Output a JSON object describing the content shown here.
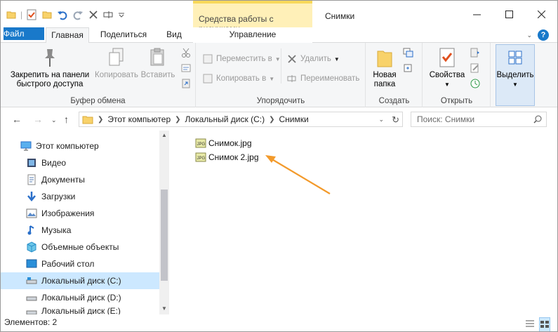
{
  "window": {
    "title": "Снимки"
  },
  "contextual_tab": {
    "header": "Средства работы с рисунками",
    "tab": "Управление"
  },
  "tabs": {
    "file": "Файл",
    "home": "Главная",
    "share": "Поделиться",
    "view": "Вид"
  },
  "ribbon": {
    "clipboard": {
      "label": "Буфер обмена",
      "pin_line1": "Закрепить на панели",
      "pin_line2": "быстрого доступа",
      "copy": "Копировать",
      "paste": "Вставить"
    },
    "organize": {
      "label": "Упорядочить",
      "move_to": "Переместить в",
      "copy_to": "Копировать в",
      "delete": "Удалить",
      "rename": "Переименовать"
    },
    "new": {
      "label": "Создать",
      "new_folder_line1": "Новая",
      "new_folder_line2": "папка"
    },
    "open": {
      "label": "Открыть",
      "properties": "Свойства"
    },
    "select": {
      "label": "Выделить"
    }
  },
  "address": {
    "crumbs": [
      "Этот компьютер",
      "Локальный диск (C:)",
      "Снимки"
    ],
    "search_placeholder": "Поиск: Снимки"
  },
  "nav": {
    "items": [
      {
        "label": "Этот компьютер",
        "icon": "computer-icon"
      },
      {
        "label": "Видео",
        "icon": "video-icon"
      },
      {
        "label": "Документы",
        "icon": "documents-icon"
      },
      {
        "label": "Загрузки",
        "icon": "downloads-icon"
      },
      {
        "label": "Изображения",
        "icon": "pictures-icon"
      },
      {
        "label": "Музыка",
        "icon": "music-icon"
      },
      {
        "label": "Объемные объекты",
        "icon": "3d-objects-icon"
      },
      {
        "label": "Рабочий стол",
        "icon": "desktop-icon"
      },
      {
        "label": "Локальный диск (C:)",
        "icon": "drive-icon"
      },
      {
        "label": "Локальный диск (D:)",
        "icon": "drive-icon"
      },
      {
        "label": "Локальный диск (E:)",
        "icon": "drive-icon"
      }
    ],
    "selected_index": 8
  },
  "files": [
    {
      "name": "Снимок.jpg",
      "icon": "jpg-file-icon"
    },
    {
      "name": "Снимок 2.jpg",
      "icon": "jpg-file-icon"
    }
  ],
  "status": {
    "items_count": "Элементов: 2"
  },
  "colors": {
    "accent": "#1979ca",
    "context_tab": "#fff0b8",
    "selection": "#cce8ff",
    "arrow": "#f39a2b"
  }
}
